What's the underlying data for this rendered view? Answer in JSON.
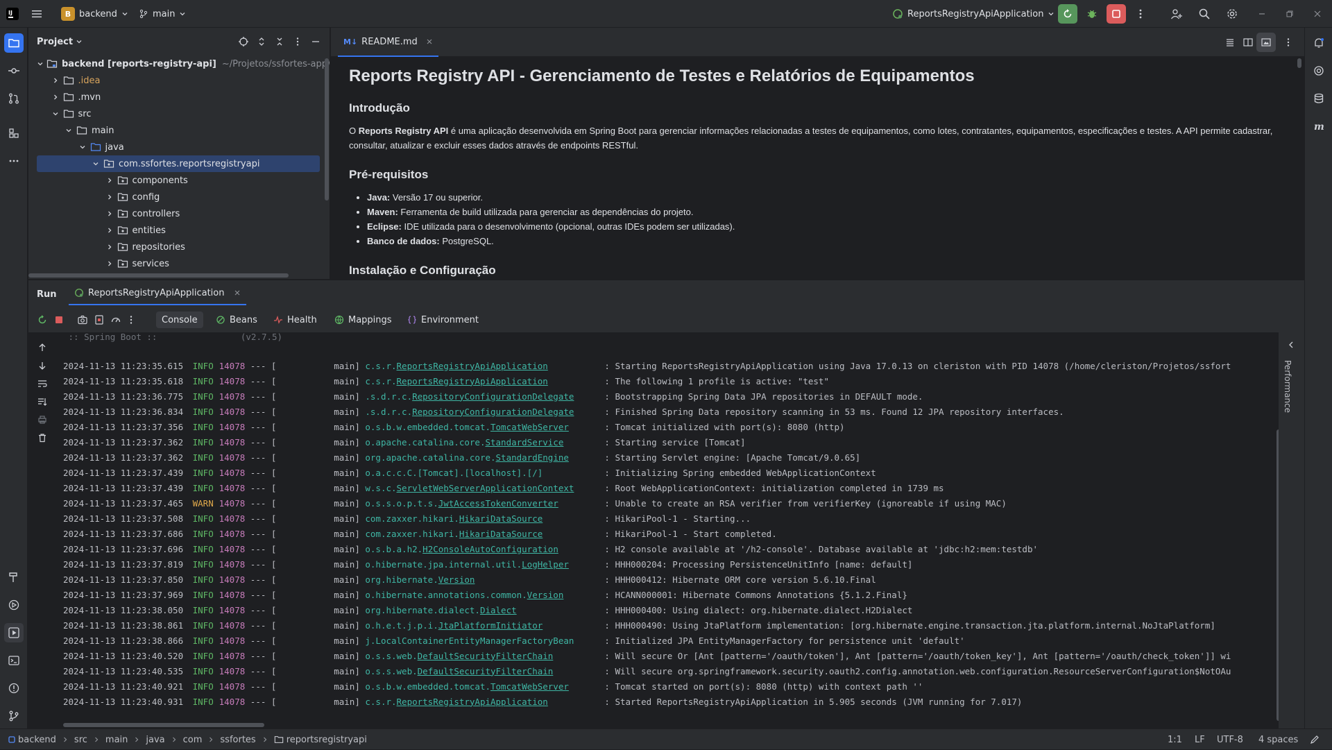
{
  "titlebar": {
    "project_badge": "B",
    "project_name": "backend",
    "branch": "main",
    "run_config": "ReportsRegistryApiApplication"
  },
  "project_panel": {
    "title": "Project",
    "tree": [
      {
        "label": "backend [reports-registry-api]",
        "hint": "~/Projetos/ssfortes-app/back"
      },
      {
        "label": ".idea"
      },
      {
        "label": ".mvn"
      },
      {
        "label": "src"
      },
      {
        "label": "main"
      },
      {
        "label": "java"
      },
      {
        "label": "com.ssfortes.reportsregistryapi"
      },
      {
        "label": "components"
      },
      {
        "label": "config"
      },
      {
        "label": "controllers"
      },
      {
        "label": "entities"
      },
      {
        "label": "repositories"
      },
      {
        "label": "services"
      }
    ]
  },
  "editor": {
    "tab_badge": "M↓",
    "tab_label": "README.md",
    "h1": "Reports Registry API - Gerenciamento de Testes e Relatórios de Equipamentos",
    "intro_heading": "Introdução",
    "intro_pre": "O ",
    "intro_bold": "Reports Registry API",
    "intro_rest": " é uma aplicação desenvolvida em Spring Boot para gerenciar informações relacionadas a testes de equipamentos, como lotes, contratantes, equipamentos, especificações e testes. A API permite cadastrar, consultar, atualizar e excluir esses dados através de endpoints RESTful.",
    "prereq_heading": "Pré-requisitos",
    "prereqs": [
      {
        "bold": "Java:",
        "text": " Versão 17 ou superior."
      },
      {
        "bold": "Maven:",
        "text": " Ferramenta de build utilizada para gerenciar as dependências do projeto."
      },
      {
        "bold": "Eclipse:",
        "text": " IDE utilizada para o desenvolvimento (opcional, outras IDEs podem ser utilizadas)."
      },
      {
        "bold": "Banco de dados:",
        "text": " PostgreSQL."
      }
    ],
    "next_heading": "Instalação e Configuração"
  },
  "run": {
    "title": "Run",
    "tab_label": "ReportsRegistryApiApplication",
    "tabs": [
      "Console",
      "Beans",
      "Health",
      "Mappings",
      "Environment"
    ],
    "banner": " :: Spring Boot ::                (v2.7.5)",
    "log": [
      {
        "ts": "2024-11-13 11:23:35.615",
        "level": "INFO",
        "pid": "14078",
        "thread": "main",
        "pre": "c.s.r.",
        "cls": "ReportsRegistryApiApplication",
        "msg": "Starting ReportsRegistryApiApplication using Java 17.0.13 on cleriston with PID 14078 (/home/cleriston/Projetos/ssfort"
      },
      {
        "ts": "2024-11-13 11:23:35.618",
        "level": "INFO",
        "pid": "14078",
        "thread": "main",
        "pre": "c.s.r.",
        "cls": "ReportsRegistryApiApplication",
        "msg": "The following 1 profile is active: \"test\""
      },
      {
        "ts": "2024-11-13 11:23:36.775",
        "level": "INFO",
        "pid": "14078",
        "thread": "main",
        "pre": ".s.d.r.c.",
        "cls": "RepositoryConfigurationDelegate",
        "msg": "Bootstrapping Spring Data JPA repositories in DEFAULT mode."
      },
      {
        "ts": "2024-11-13 11:23:36.834",
        "level": "INFO",
        "pid": "14078",
        "thread": "main",
        "pre": ".s.d.r.c.",
        "cls": "RepositoryConfigurationDelegate",
        "msg": "Finished Spring Data repository scanning in 53 ms. Found 12 JPA repository interfaces."
      },
      {
        "ts": "2024-11-13 11:23:37.356",
        "level": "INFO",
        "pid": "14078",
        "thread": "main",
        "pre": "o.s.b.w.embedded.tomcat.",
        "cls": "TomcatWebServer",
        "msg": "Tomcat initialized with port(s): 8080 (http)"
      },
      {
        "ts": "2024-11-13 11:23:37.362",
        "level": "INFO",
        "pid": "14078",
        "thread": "main",
        "pre": "o.apache.catalina.core.",
        "cls": "StandardService",
        "msg": "Starting service [Tomcat]"
      },
      {
        "ts": "2024-11-13 11:23:37.362",
        "level": "INFO",
        "pid": "14078",
        "thread": "main",
        "pre": "org.apache.catalina.core.",
        "cls": "StandardEngine",
        "msg": "Starting Servlet engine: [Apache Tomcat/9.0.65]"
      },
      {
        "ts": "2024-11-13 11:23:37.439",
        "level": "INFO",
        "pid": "14078",
        "thread": "main",
        "pre": "o.a.c.c.C.[Tomcat].[localhost].[/]",
        "cls": "",
        "msg": "Initializing Spring embedded WebApplicationContext"
      },
      {
        "ts": "2024-11-13 11:23:37.439",
        "level": "INFO",
        "pid": "14078",
        "thread": "main",
        "pre": "w.s.c.",
        "cls": "ServletWebServerApplicationContext",
        "msg": "Root WebApplicationContext: initialization completed in 1739 ms"
      },
      {
        "ts": "2024-11-13 11:23:37.465",
        "level": "WARN",
        "pid": "14078",
        "thread": "main",
        "pre": "o.s.s.o.p.t.s.",
        "cls": "JwtAccessTokenConverter",
        "msg": "Unable to create an RSA verifier from verifierKey (ignoreable if using MAC)"
      },
      {
        "ts": "2024-11-13 11:23:37.508",
        "level": "INFO",
        "pid": "14078",
        "thread": "main",
        "pre": "com.zaxxer.hikari.",
        "cls": "HikariDataSource",
        "msg": "HikariPool-1 - Starting..."
      },
      {
        "ts": "2024-11-13 11:23:37.686",
        "level": "INFO",
        "pid": "14078",
        "thread": "main",
        "pre": "com.zaxxer.hikari.",
        "cls": "HikariDataSource",
        "msg": "HikariPool-1 - Start completed."
      },
      {
        "ts": "2024-11-13 11:23:37.696",
        "level": "INFO",
        "pid": "14078",
        "thread": "main",
        "pre": "o.s.b.a.h2.",
        "cls": "H2ConsoleAutoConfiguration",
        "msg": "H2 console available at '/h2-console'. Database available at 'jdbc:h2:mem:testdb'"
      },
      {
        "ts": "2024-11-13 11:23:37.819",
        "level": "INFO",
        "pid": "14078",
        "thread": "main",
        "pre": "o.hibernate.jpa.internal.util.",
        "cls": "LogHelper",
        "msg": "HHH000204: Processing PersistenceUnitInfo [name: default]"
      },
      {
        "ts": "2024-11-13 11:23:37.850",
        "level": "INFO",
        "pid": "14078",
        "thread": "main",
        "pre": "org.hibernate.",
        "cls": "Version",
        "msg": "HHH000412: Hibernate ORM core version 5.6.10.Final"
      },
      {
        "ts": "2024-11-13 11:23:37.969",
        "level": "INFO",
        "pid": "14078",
        "thread": "main",
        "pre": "o.hibernate.annotations.common.",
        "cls": "Version",
        "msg": "HCANN000001: Hibernate Commons Annotations {5.1.2.Final}"
      },
      {
        "ts": "2024-11-13 11:23:38.050",
        "level": "INFO",
        "pid": "14078",
        "thread": "main",
        "pre": "org.hibernate.dialect.",
        "cls": "Dialect",
        "msg": "HHH000400: Using dialect: org.hibernate.dialect.H2Dialect"
      },
      {
        "ts": "2024-11-13 11:23:38.861",
        "level": "INFO",
        "pid": "14078",
        "thread": "main",
        "pre": "o.h.e.t.j.p.i.",
        "cls": "JtaPlatformInitiator",
        "msg": "HHH000490: Using JtaPlatform implementation: [org.hibernate.engine.transaction.jta.platform.internal.NoJtaPlatform]"
      },
      {
        "ts": "2024-11-13 11:23:38.866",
        "level": "INFO",
        "pid": "14078",
        "thread": "main",
        "pre": "j.LocalContainerEntityManagerFactoryBean",
        "cls": "",
        "msg": "Initialized JPA EntityManagerFactory for persistence unit 'default'"
      },
      {
        "ts": "2024-11-13 11:23:40.520",
        "level": "INFO",
        "pid": "14078",
        "thread": "main",
        "pre": "o.s.s.web.",
        "cls": "DefaultSecurityFilterChain",
        "msg": "Will secure Or [Ant [pattern='/oauth/token'], Ant [pattern='/oauth/token_key'], Ant [pattern='/oauth/check_token']] wi"
      },
      {
        "ts": "2024-11-13 11:23:40.535",
        "level": "INFO",
        "pid": "14078",
        "thread": "main",
        "pre": "o.s.s.web.",
        "cls": "DefaultSecurityFilterChain",
        "msg": "Will secure org.springframework.security.oauth2.config.annotation.web.configuration.ResourceServerConfiguration$NotOAu"
      },
      {
        "ts": "2024-11-13 11:23:40.921",
        "level": "INFO",
        "pid": "14078",
        "thread": "main",
        "pre": "o.s.b.w.embedded.tomcat.",
        "cls": "TomcatWebServer",
        "msg": "Tomcat started on port(s): 8080 (http) with context path ''"
      },
      {
        "ts": "2024-11-13 11:23:40.931",
        "level": "INFO",
        "pid": "14078",
        "thread": "main",
        "pre": "c.s.r.",
        "cls": "ReportsRegistryApiApplication",
        "msg": "Started ReportsRegistryApiApplication in 5.905 seconds (JVM running for 7.017)"
      }
    ],
    "side_label": "Performance"
  },
  "statusbar": {
    "crumbs": [
      "backend",
      "src",
      "main",
      "java",
      "com",
      "ssfortes",
      "reportsregistryapi"
    ],
    "position": "1:1",
    "line_sep": "LF",
    "encoding": "UTF-8",
    "indent": "4 spaces"
  },
  "colors": {
    "accent": "#3574f0",
    "run_green": "#57965c",
    "stop_red": "#db5c5c",
    "info": "#5fb865",
    "warn": "#e0a94b"
  }
}
